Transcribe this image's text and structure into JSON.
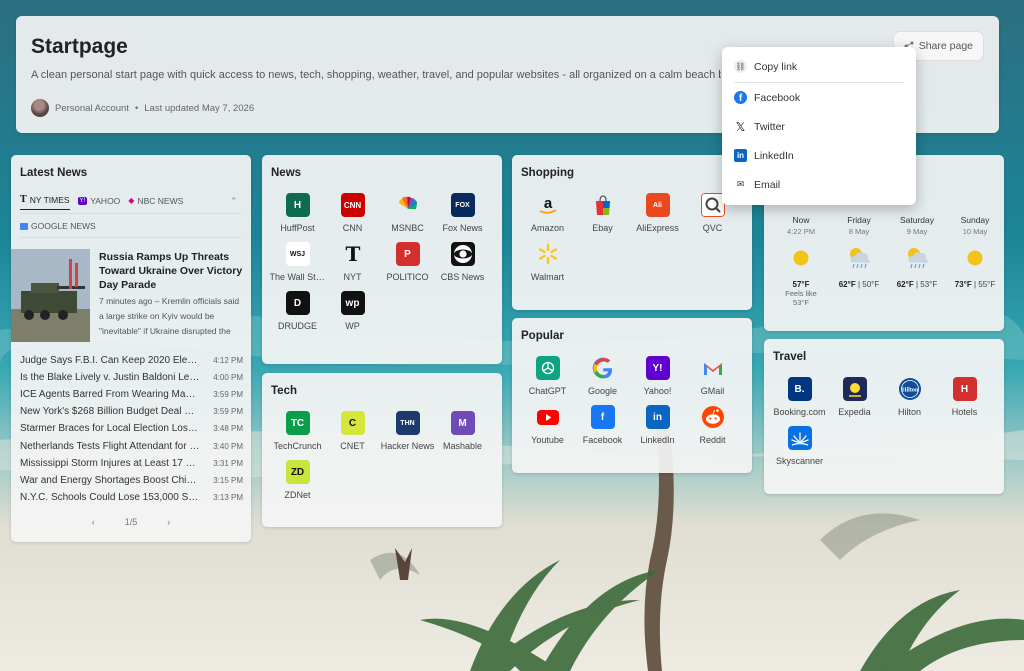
{
  "header": {
    "title": "Startpage",
    "description": "A clean personal start page with quick access to news, tech, shopping, weather, travel, and popular websites - all organized on a calm beach background.",
    "account": "Personal Account",
    "separator": "•",
    "updated": "Last updated May 7, 2026",
    "share_label": "Share page"
  },
  "share_menu": {
    "copy": "Copy link",
    "facebook": "Facebook",
    "twitter": "Twitter",
    "linkedin": "LinkedIn",
    "email": "Email"
  },
  "latest_news": {
    "title": "Latest News",
    "tabs": [
      "NY TIMES",
      "YAHOO",
      "NBC NEWS"
    ],
    "tab2": "GOOGLE NEWS",
    "featured": {
      "title": "Russia Ramps Up Threats Toward Ukraine Over Victory Day Parade",
      "summary": "7 minutes ago – Kremlin officials said a large strike on Kyiv would be \"inevitable\" if Ukraine disrupted the"
    },
    "headlines": [
      {
        "text": "Judge Says F.B.I. Can Keep 2020 Election Records",
        "time": "4:12 PM"
      },
      {
        "text": "Is the Blake Lively v. Justin Baldoni Legal Fight Over?",
        "time": "4:00 PM"
      },
      {
        "text": "ICE Agents Barred From Wearing Masks in California",
        "time": "3:59 PM"
      },
      {
        "text": "New York's $268 Billion Budget Deal Reached",
        "time": "3:59 PM"
      },
      {
        "text": "Starmer Braces for Local Election Losses",
        "time": "3:48 PM"
      },
      {
        "text": "Netherlands Tests Flight Attendant for Virus",
        "time": "3:40 PM"
      },
      {
        "text": "Mississippi Storm Injures at Least 17 as Tornado Hits",
        "time": "3:31 PM"
      },
      {
        "text": "War and Energy Shortages Boost China's Exports",
        "time": "3:15 PM"
      },
      {
        "text": "N.Y.C. Schools Could Lose 153,000 Students",
        "time": "3:13 PM"
      }
    ],
    "pager": {
      "prev": "‹",
      "page": "1/5",
      "next": "›"
    }
  },
  "news": {
    "title": "News",
    "items": [
      {
        "label": "HuffPost",
        "glyph": "H",
        "bg": "#0d6b4e"
      },
      {
        "label": "CNN",
        "glyph": "CNN",
        "bg": "#cc0000"
      },
      {
        "label": "MSNBC",
        "glyph": "",
        "bg": "transparent"
      },
      {
        "label": "Fox News",
        "glyph": "FOX",
        "bg": "#0b2a5b"
      },
      {
        "label": "The Wall Street Journal",
        "glyph": "WSJ",
        "bg": "#ffffff"
      },
      {
        "label": "NYT",
        "glyph": "𝕿",
        "bg": "#ffffff"
      },
      {
        "label": "POLITICO",
        "glyph": "P",
        "bg": "#d32f2f"
      },
      {
        "label": "CBS News",
        "glyph": "",
        "bg": "#111111"
      },
      {
        "label": "DRUDGE",
        "glyph": "D",
        "bg": "#111111"
      },
      {
        "label": "WP",
        "glyph": "wp",
        "bg": "#111111"
      }
    ]
  },
  "tech": {
    "title": "Tech",
    "items": [
      {
        "label": "TechCrunch",
        "glyph": "TC",
        "bg": "#0a9e4a"
      },
      {
        "label": "CNET",
        "glyph": "C",
        "bg": "#d6e63c"
      },
      {
        "label": "Hacker News",
        "glyph": "THN",
        "bg": "#1c3a6b"
      },
      {
        "label": "Mashable",
        "glyph": "M",
        "bg": "#6f4bb8"
      },
      {
        "label": "ZDNet",
        "glyph": "ZD",
        "bg": "#c7e53a"
      }
    ]
  },
  "shopping": {
    "title": "Shopping",
    "items": [
      {
        "label": "Amazon",
        "glyph": "a",
        "bg": "transparent"
      },
      {
        "label": "Ebay",
        "glyph": "",
        "bg": "transparent"
      },
      {
        "label": "AliExpress",
        "glyph": "Ali",
        "bg": "#e8491d"
      },
      {
        "label": "QVC",
        "glyph": "Q",
        "bg": "#ffffff"
      },
      {
        "label": "Walmart",
        "glyph": "✻",
        "bg": "transparent"
      }
    ]
  },
  "popular": {
    "title": "Popular",
    "items": [
      {
        "label": "ChatGPT",
        "glyph": "✺",
        "bg": "#10a37f"
      },
      {
        "label": "Google",
        "glyph": "G",
        "bg": "transparent"
      },
      {
        "label": "Yahoo!",
        "glyph": "Y!",
        "bg": "#6001d2"
      },
      {
        "label": "GMail",
        "glyph": "M",
        "bg": "transparent"
      },
      {
        "label": "Youtube",
        "glyph": "▶",
        "bg": "#ff0000"
      },
      {
        "label": "Facebook",
        "glyph": "f",
        "bg": "#1877f2"
      },
      {
        "label": "LinkedIn",
        "glyph": "in",
        "bg": "#0a66c2"
      },
      {
        "label": "Reddit",
        "glyph": "●",
        "bg": "#ff4500"
      }
    ]
  },
  "weather": {
    "days": [
      {
        "day": "Now",
        "date": "4:22 PM",
        "icon": "sun",
        "hi": "57°F",
        "lo": "",
        "feels": "Feels like 53°F"
      },
      {
        "day": "Friday",
        "date": "8 May",
        "icon": "rain",
        "hi": "62°F",
        "lo": "50°F",
        "feels": ""
      },
      {
        "day": "Saturday",
        "date": "9 May",
        "icon": "rain",
        "hi": "62°F",
        "lo": "53°F",
        "feels": ""
      },
      {
        "day": "Sunday",
        "date": "10 May",
        "icon": "sun",
        "hi": "73°F",
        "lo": "55°F",
        "feels": ""
      }
    ]
  },
  "travel": {
    "title": "Travel",
    "items": [
      {
        "label": "Booking.com",
        "glyph": "B.",
        "bg": "#003580"
      },
      {
        "label": "Expedia",
        "glyph": "✈",
        "bg": "#1e2a5a"
      },
      {
        "label": "Hilton",
        "glyph": "H",
        "bg": "#104c97"
      },
      {
        "label": "Hotels",
        "glyph": "H",
        "bg": "#d32f2f"
      },
      {
        "label": "Skyscanner",
        "glyph": "☀",
        "bg": "#0770e3"
      }
    ]
  }
}
